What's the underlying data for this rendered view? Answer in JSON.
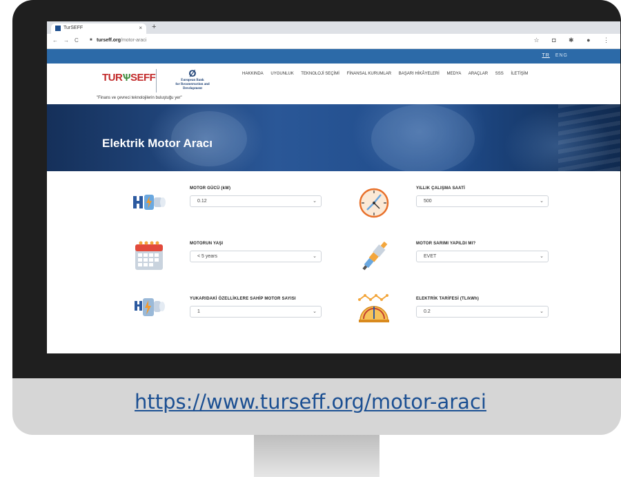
{
  "browser": {
    "tab_title": "TurSEFF",
    "tab_close": "×",
    "new_tab": "+",
    "back": "←",
    "forward": "→",
    "reload": "C",
    "url_host": "turseff.org",
    "url_path": "/motor-araci",
    "toolbar_icons": "☆ ◘ ✱ ● ⋮"
  },
  "site": {
    "lang_active": "TR",
    "lang_other": "ENG",
    "logo_left": "TUR",
    "logo_mid": "Ѱ",
    "logo_right": "SEFF",
    "ebrd_mark": "Ø",
    "ebrd_line1": "European Bank",
    "ebrd_line2": "for Reconstruction and Development",
    "tagline": "\"Finans ve çevreci teknolojilerin buluştuğu yer\"",
    "nav": [
      "HAKKINDA",
      "UYGUNLUK",
      "TEKNOLOJİ SEÇİMİ",
      "FİNANSAL KURUMLAR",
      "BAŞARI HİKÂYELERİ",
      "MEDYA",
      "ARAÇLAR",
      "SSS",
      "İLETİŞİM"
    ],
    "hero_title": "Elektrik Motor Aracı"
  },
  "form": {
    "motor_power": {
      "label": "MOTOR GÜCÜ (kW)",
      "value": "0.12"
    },
    "annual_hours": {
      "label": "YILLIK ÇALIŞMA SAATİ",
      "value": "500"
    },
    "motor_age": {
      "label": "MOTORUN YAŞI",
      "value": "< 5 years"
    },
    "rewound": {
      "label": "MOTOR SARIMI YAPILDI MI?",
      "value": "EVET"
    },
    "motor_count": {
      "label": "YUKARIDAKİ ÖZELLİKLERE SAHİP MOTOR SAYISI",
      "value": "1"
    },
    "tariff": {
      "label": "ELEKTRİK TARİFESİ (TL/kWh)",
      "value": "0.2"
    },
    "chevron": "⌄"
  },
  "caption": "https://www.turseff.org/motor-araci",
  "colors": {
    "brand_blue": "#2c6aa8",
    "logo_red": "#c22a2a",
    "link_blue": "#1b4f92"
  }
}
